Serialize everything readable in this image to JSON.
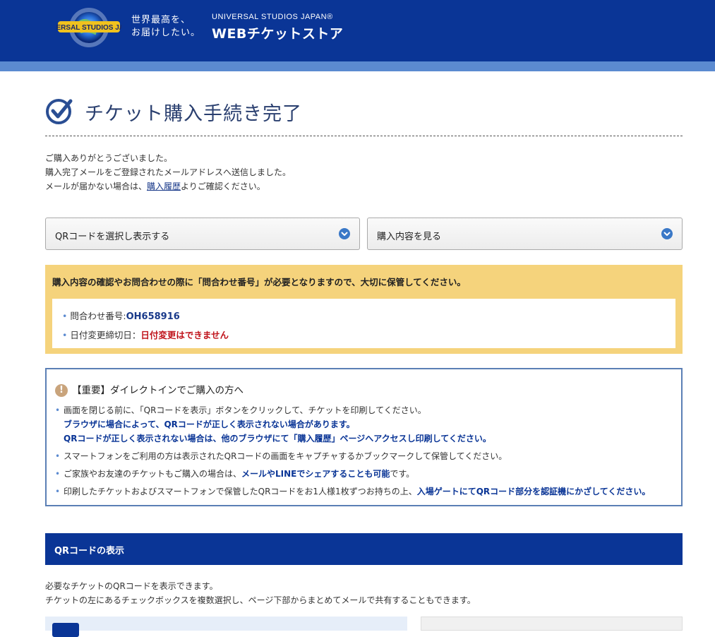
{
  "header": {
    "logo_text": "UNIVERSAL STUDIOS JAPAN",
    "tagline_line1": "世界最高を、",
    "tagline_line2": "お届けしたい。",
    "brand_sub": "UNIVERSAL STUDIOS JAPAN®",
    "brand_main": "WEBチケットストア"
  },
  "page": {
    "title": "チケット購入手続き完了"
  },
  "intro": {
    "line1": "ご購入ありがとうございました。",
    "line2": "購入完了メールをご登録されたメールアドレスへ送信しました。",
    "line3_before": "メールが届かない場合は、",
    "line3_link": "購入履歴",
    "line3_after": "よりご確認ください。"
  },
  "dropdowns": {
    "qr_select": "QRコードを選択し表示する",
    "view_purchase": "購入内容を見る"
  },
  "notice": {
    "heading": "購入内容の確認やお問合わせの際に「問合わせ番号」が必要となりますので、大切に保管してください。",
    "inquiry_label": "問合わせ番号:",
    "inquiry_number": "OH658916",
    "deadline_label": "日付変更締切日：",
    "deadline_value": "日付変更はできません"
  },
  "important": {
    "heading": "【重要】ダイレクトインでご購入の方へ",
    "item1": "画面を閉じる前に、「QRコードを表示」ボタンをクリックして、チケットを印刷してください。",
    "item1_b1": "ブラウザに場合によって、QRコードが正しく表示されない場合があります。",
    "item1_b2": "QRコードが正しく表示されない場合は、他のブラウザにて「購入履歴」ページへアクセスし印刷してください。",
    "item2": "スマートフォンをご利用の方は表示されたQRコードの画面をキャプチャするかブックマークして保管してください。",
    "item3_before": "ご家族やお友達のチケットもご購入の場合は、",
    "item3_bold": "メールやLINEでシェアすることも可能",
    "item3_after": "です。",
    "item4_before": "印刷したチケットおよびスマートフォンで保管したQRコードをお1人様1枚ずつお持ちの上、",
    "item4_bold": "入場ゲートにてQRコード部分を認証機にかざしてください。"
  },
  "qr_section": {
    "title": "QRコードの表示",
    "desc1": "必要なチケットのQRコードを表示できます。",
    "desc2": "チケットの左にあるチェックボックスを複数選択し、ページ下部からまとめてメールで共有することもできます。"
  },
  "colors": {
    "header_bg": "#0a3596",
    "stripe": "#5b8ad0",
    "notice_bg": "#f5d37c",
    "alert_red": "#c0141c"
  }
}
